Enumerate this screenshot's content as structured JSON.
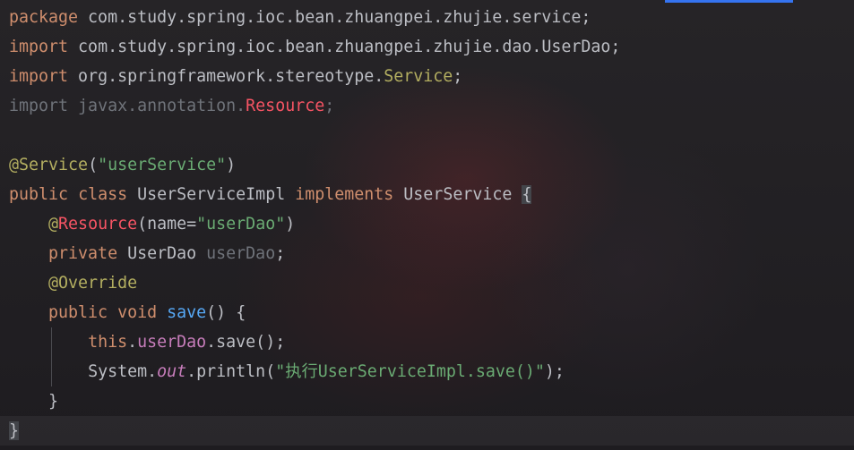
{
  "editor": {
    "lines": {
      "l1": {
        "kw": "package",
        "rest": " com.study.spring.ioc.bean.zhuangpei.zhujie.service;"
      },
      "l2": {
        "kw": "import",
        "rest": " com.study.spring.ioc.bean.zhuangpei.zhujie.dao.UserDao;"
      },
      "l3": {
        "kw": "import",
        "rest": " org.springframework.stereotype.",
        "cls": "Service",
        "end": ";"
      },
      "l4": {
        "kw": "import",
        "rest": " javax.annotation.",
        "cls": "Resource",
        "end": ";"
      },
      "l6": {
        "ann": "@Service",
        "open": "(",
        "str": "\"userService\"",
        "close": ")"
      },
      "l7": {
        "kw1": "public",
        "kw2": "class",
        "name": "UserServiceImpl",
        "kw3": "implements",
        "iface": "UserService",
        "brace": "{"
      },
      "l8": {
        "at": "@",
        "ann": "Resource",
        "open": "(name=",
        "str": "\"userDao\"",
        "close": ")"
      },
      "l9": {
        "kw": "private",
        "type": "UserDao",
        "field": "userDao",
        "end": ";"
      },
      "l10": {
        "ann": "@Override"
      },
      "l11": {
        "kw1": "public",
        "kw2": "void",
        "method": "save",
        "rest": "() {"
      },
      "l12": {
        "kw": "this",
        "dot": ".",
        "field": "userDao",
        "rest": ".save();"
      },
      "l13": {
        "cls": "System.",
        "stat": "out",
        "mid": ".println(",
        "str": "\"执行UserServiceImpl.save()\"",
        "end": ");"
      },
      "l14": {
        "brace": "}"
      },
      "l15": {
        "brace": "}"
      }
    }
  }
}
